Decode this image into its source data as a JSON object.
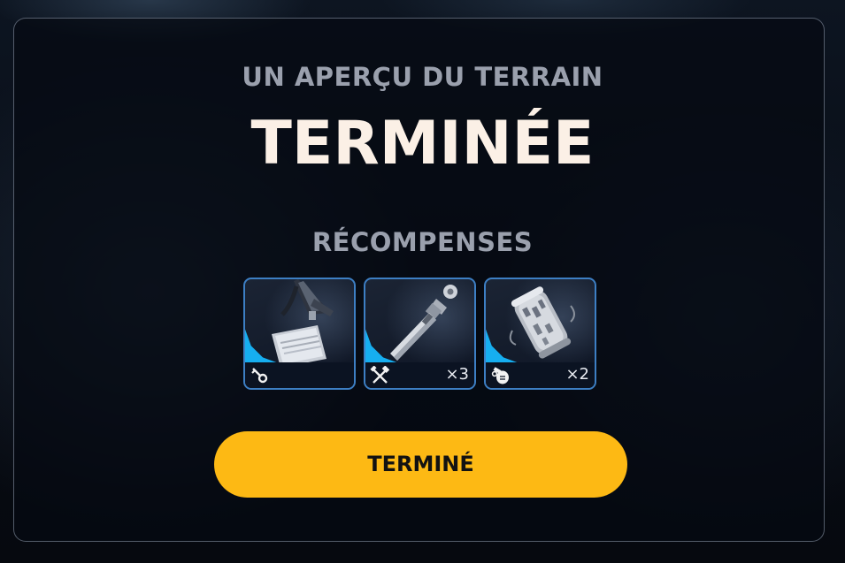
{
  "header": {
    "subtitle": "UN APERÇU DU TERRAIN",
    "title": "TERMINÉE"
  },
  "rewards": {
    "heading": "RÉCOMPENSES",
    "items": [
      {
        "item": "id-badge",
        "category_icon": "key-icon",
        "quantity": ""
      },
      {
        "item": "metal-pipe-part",
        "category_icon": "crossed-tools-icon",
        "quantity": "×3"
      },
      {
        "item": "canister",
        "category_icon": "grenade-icon",
        "quantity": "×2"
      }
    ]
  },
  "actions": {
    "done_label": "TERMINÉ"
  },
  "colors": {
    "accent_blue": "#16aef0",
    "card_border": "#3d7fc4",
    "button_yellow": "#fdb914",
    "title_cream": "#fbf0e6",
    "subtitle_gray": "#9aa0ad"
  }
}
